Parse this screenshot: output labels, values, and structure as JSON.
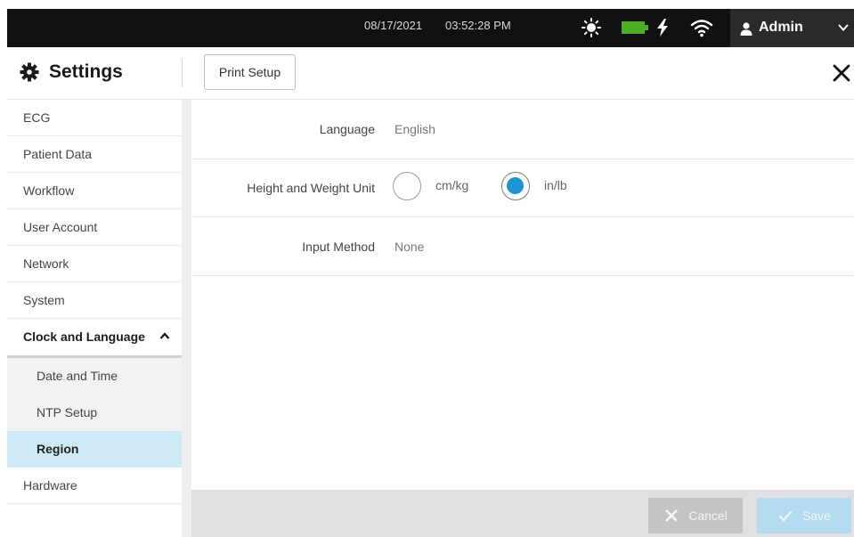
{
  "status_bar": {
    "date": "08/17/2021",
    "time": "03:52:28 PM",
    "icons": [
      "brightness-icon",
      "battery-icon",
      "charging-icon",
      "wifi-icon"
    ],
    "battery_color": "#4caf26",
    "user_label": "Admin"
  },
  "header": {
    "title": "Settings",
    "print_setup_label": "Print Setup"
  },
  "sidebar": {
    "items": [
      {
        "label": "ECG"
      },
      {
        "label": "Patient Data"
      },
      {
        "label": "Workflow"
      },
      {
        "label": "User Account"
      },
      {
        "label": "Network"
      },
      {
        "label": "System"
      },
      {
        "label": "Clock and Language",
        "expanded": true
      },
      {
        "label": "Date and Time"
      },
      {
        "label": "NTP Setup"
      },
      {
        "label": "Region",
        "selected": true
      },
      {
        "label": "Hardware"
      }
    ]
  },
  "main": {
    "language": {
      "label": "Language",
      "value": "English"
    },
    "unit": {
      "label": "Height and Weight Unit",
      "options": [
        {
          "label": "cm/kg",
          "selected": false
        },
        {
          "label": "in/lb",
          "selected": true
        }
      ]
    },
    "input_method": {
      "label": "Input Method",
      "value": "None"
    }
  },
  "footer": {
    "cancel_label": "Cancel",
    "save_label": "Save"
  },
  "colors": {
    "accent": "#1e94d3",
    "selected_row": "#cde9f5",
    "top_bar": "#111111"
  }
}
